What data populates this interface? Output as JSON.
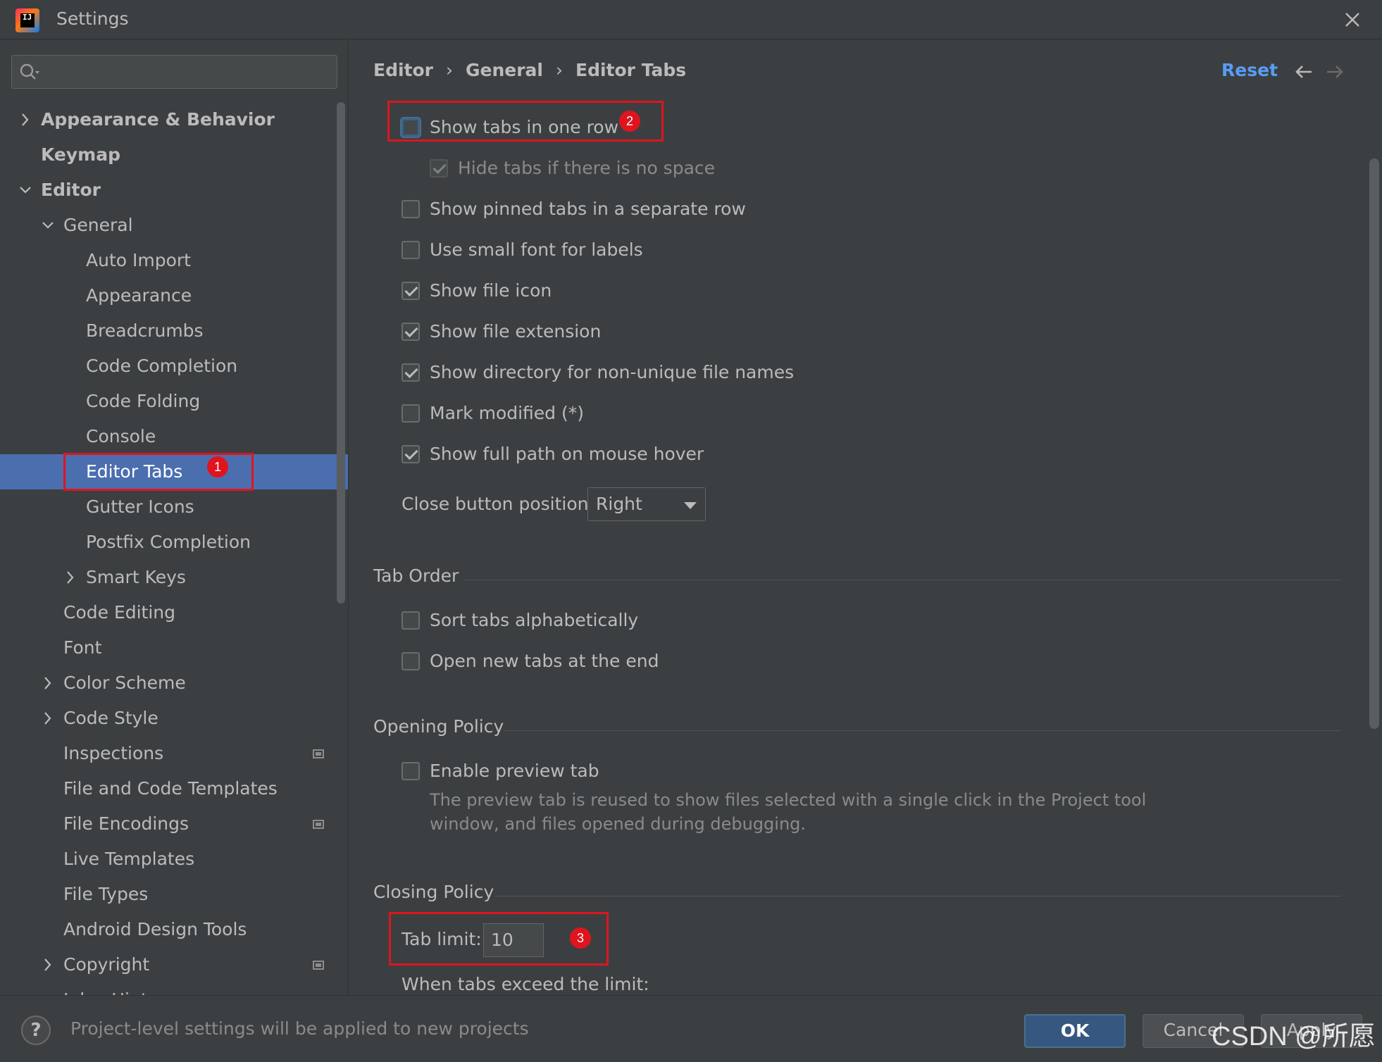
{
  "window": {
    "title": "Settings"
  },
  "search": {
    "placeholder": "",
    "value": ""
  },
  "tree": [
    {
      "label": "Appearance & Behavior",
      "bold": true,
      "arrow": "right"
    },
    {
      "label": "Keymap",
      "bold": true,
      "arrow": ""
    },
    {
      "label": "Editor",
      "bold": true,
      "arrow": "down"
    },
    {
      "label": "General",
      "bold": false,
      "arrow": "down"
    },
    {
      "label": "Auto Import",
      "bold": false,
      "arrow": ""
    },
    {
      "label": "Appearance",
      "bold": false,
      "arrow": ""
    },
    {
      "label": "Breadcrumbs",
      "bold": false,
      "arrow": ""
    },
    {
      "label": "Code Completion",
      "bold": false,
      "arrow": ""
    },
    {
      "label": "Code Folding",
      "bold": false,
      "arrow": ""
    },
    {
      "label": "Console",
      "bold": false,
      "arrow": ""
    },
    {
      "label": "Editor Tabs",
      "bold": false,
      "arrow": "",
      "selected": true
    },
    {
      "label": "Gutter Icons",
      "bold": false,
      "arrow": ""
    },
    {
      "label": "Postfix Completion",
      "bold": false,
      "arrow": ""
    },
    {
      "label": "Smart Keys",
      "bold": false,
      "arrow": "right"
    },
    {
      "label": "Code Editing",
      "bold": false,
      "arrow": ""
    },
    {
      "label": "Font",
      "bold": false,
      "arrow": ""
    },
    {
      "label": "Color Scheme",
      "bold": false,
      "arrow": "right"
    },
    {
      "label": "Code Style",
      "bold": false,
      "arrow": "right"
    },
    {
      "label": "Inspections",
      "bold": false,
      "arrow": "",
      "project": true
    },
    {
      "label": "File and Code Templates",
      "bold": false,
      "arrow": ""
    },
    {
      "label": "File Encodings",
      "bold": false,
      "arrow": "",
      "project": true
    },
    {
      "label": "Live Templates",
      "bold": false,
      "arrow": ""
    },
    {
      "label": "File Types",
      "bold": false,
      "arrow": ""
    },
    {
      "label": "Android Design Tools",
      "bold": false,
      "arrow": ""
    },
    {
      "label": "Copyright",
      "bold": false,
      "arrow": "right",
      "project": true
    },
    {
      "label": "Inlay Hints",
      "bold": false,
      "arrow": "",
      "project": true
    }
  ],
  "breadcrumb": {
    "part1": "Editor",
    "part2": "General",
    "part3": "Editor Tabs",
    "sep": "›"
  },
  "header": {
    "reset": "Reset"
  },
  "options": {
    "show_tabs_one_row": {
      "label": "Show tabs in one row",
      "checked": false
    },
    "hide_tabs_no_space": {
      "label": "Hide tabs if there is no space",
      "checked": true
    },
    "pinned_separate_row": {
      "label": "Show pinned tabs in a separate row",
      "checked": false
    },
    "small_font": {
      "label": "Use small font for labels",
      "checked": false
    },
    "file_icon": {
      "label": "Show file icon",
      "checked": true
    },
    "file_extension": {
      "label": "Show file extension",
      "checked": true
    },
    "directory_nonunique": {
      "label": "Show directory for non-unique file names",
      "checked": true
    },
    "mark_modified": {
      "label": "Mark modified (*)",
      "checked": false
    },
    "full_path_hover": {
      "label": "Show full path on mouse hover",
      "checked": true
    }
  },
  "close_button": {
    "label": "Close button position:",
    "value": "Right"
  },
  "tab_order": {
    "title": "Tab Order",
    "sort_alpha": {
      "label": "Sort tabs alphabetically",
      "checked": false
    },
    "open_at_end": {
      "label": "Open new tabs at the end",
      "checked": false
    }
  },
  "opening_policy": {
    "title": "Opening Policy",
    "preview_tab": {
      "label": "Enable preview tab",
      "checked": false
    },
    "hint_line1": "The preview tab is reused to show files selected with a single click in the Project tool",
    "hint_line2": "window, and files opened during debugging."
  },
  "closing_policy": {
    "title": "Closing Policy",
    "tab_limit_label": "Tab limit:",
    "tab_limit_value": "10",
    "exceed_label": "When tabs exceed the limit:"
  },
  "annotations": {
    "badge1": "1",
    "badge2": "2",
    "badge3": "3"
  },
  "footer": {
    "message": "Project-level settings will be applied to new projects",
    "help": "?",
    "ok": "OK",
    "cancel": "Cancel",
    "apply": "Apply"
  },
  "watermark": "CSDN @所愿",
  "colors": {
    "accent": "#589df6",
    "selection": "#4b6eaf",
    "annotation": "#e0141e",
    "background": "#3c3f41"
  }
}
